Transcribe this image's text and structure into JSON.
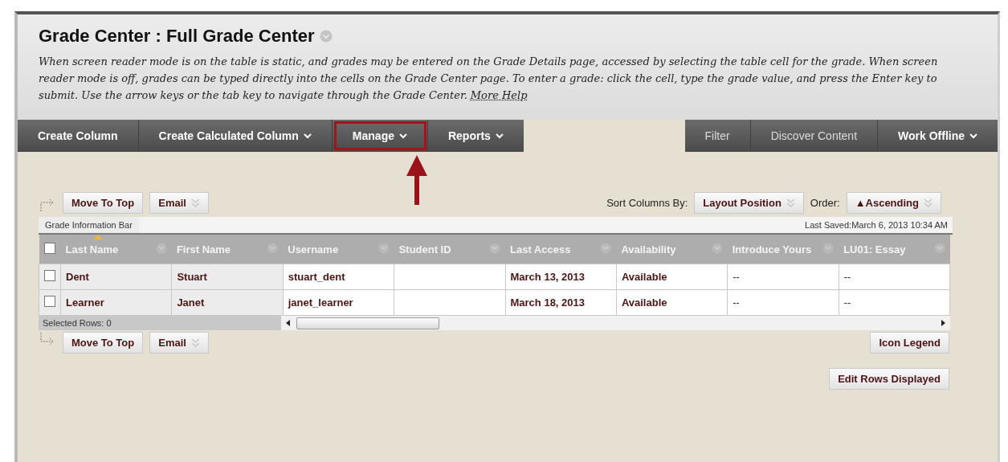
{
  "page": {
    "title": "Grade Center : Full Grade Center",
    "description": "*When screen reader mode is on the table is static, and grades may be entered on the Grade Details page, accessed by selecting the table cell for the grade. When screen reader mode is off, grades can be typed directly into the cells on the Grade Center page. To enter a grade: click the cell, type the grade value, and press the Enter key to submit. Use the arrow keys or the tab key to navigate through the Grade Center.*",
    "help_link": "More Help"
  },
  "nav_left": [
    {
      "label": "Create Column",
      "dropdown": false,
      "annotated": false
    },
    {
      "label": "Create Calculated Column",
      "dropdown": true,
      "annotated": false
    },
    {
      "label": "Manage",
      "dropdown": true,
      "annotated": true
    },
    {
      "label": "Reports",
      "dropdown": true,
      "annotated": false
    }
  ],
  "nav_right": [
    {
      "label": "Filter",
      "dropdown": false,
      "bold": false
    },
    {
      "label": "Discover Content",
      "dropdown": false,
      "bold": false
    },
    {
      "label": "Work Offline",
      "dropdown": true,
      "bold": true
    }
  ],
  "top_actions": [
    {
      "label": "Move To Top",
      "dropdown": false
    },
    {
      "label": "Email",
      "dropdown": true
    }
  ],
  "sort": {
    "label": "Sort Columns By:",
    "value": "Layout Position",
    "order_label": "Order:",
    "order_value": "▲Ascending"
  },
  "info_bar": {
    "label": "Grade Information Bar",
    "last_saved": "Last Saved:March 6, 2013 10:34 AM"
  },
  "table": {
    "select_all_checked": false,
    "columns": [
      {
        "label": "Last Name",
        "frozen": true,
        "sorted": true
      },
      {
        "label": "First Name",
        "frozen": true,
        "sorted": false
      },
      {
        "label": "Username",
        "frozen": false,
        "sorted": false
      },
      {
        "label": "Student ID",
        "frozen": false,
        "sorted": false
      },
      {
        "label": "Last Access",
        "frozen": false,
        "sorted": false
      },
      {
        "label": "Availability",
        "frozen": false,
        "sorted": false
      },
      {
        "label": "Introduce Yours",
        "frozen": false,
        "sorted": false
      },
      {
        "label": "LU01: Essay",
        "frozen": false,
        "sorted": false
      }
    ],
    "rows": [
      {
        "checked": false,
        "cells": [
          "Dent",
          "Stuart",
          "stuart_dent",
          "",
          "March 13, 2013",
          "Available",
          "--",
          "--"
        ]
      },
      {
        "checked": false,
        "cells": [
          "Learner",
          "Janet",
          "janet_learner",
          "",
          "March 18, 2013",
          "Available",
          "--",
          "--"
        ]
      }
    ],
    "selected_rows": "Selected Rows: 0"
  },
  "bottom_actions": [
    {
      "label": "Move To Top",
      "dropdown": false
    },
    {
      "label": "Email",
      "dropdown": true
    }
  ],
  "icon_legend": "Icon Legend",
  "edit_rows": "Edit Rows Displayed"
}
